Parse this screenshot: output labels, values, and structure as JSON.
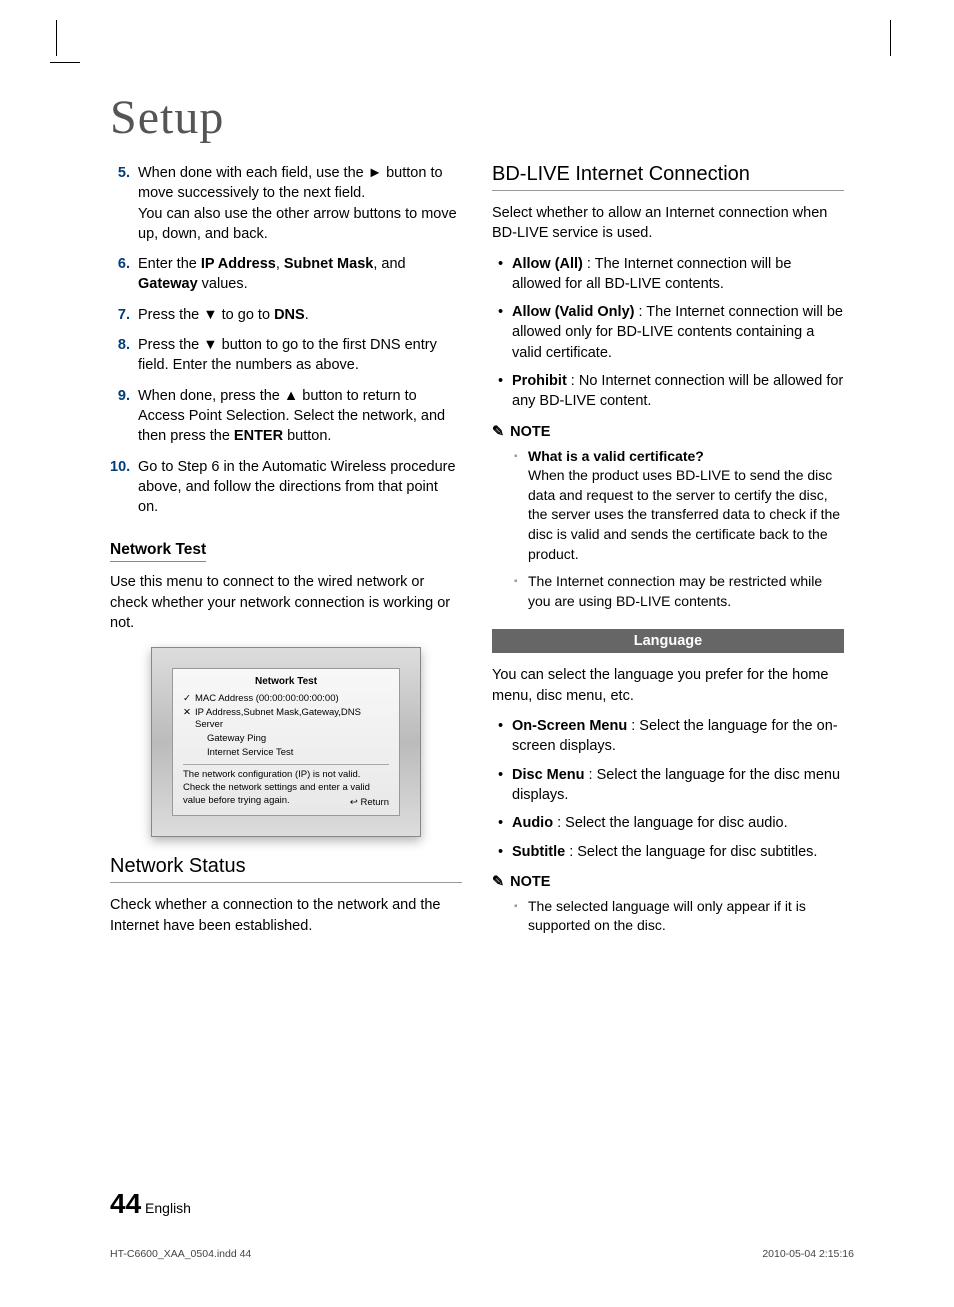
{
  "title": "Setup",
  "steps": [
    {
      "n": "5.",
      "html": "When done with each field, use the ► button to move successively to the next field.<br>You can also use the other arrow buttons to move up, down, and back."
    },
    {
      "n": "6.",
      "html": "Enter the <b>IP Address</b>, <b>Subnet Mask</b>, and <b>Gateway</b> values."
    },
    {
      "n": "7.",
      "html": "Press the ▼ to go to <b>DNS</b>."
    },
    {
      "n": "8.",
      "html": "Press the ▼ button to go to the first DNS entry field. Enter the numbers as above."
    },
    {
      "n": "9.",
      "html": "When done, press the ▲ button to return to Access Point Selection. Select the network, and then press the <b>ENTER</b> button."
    },
    {
      "n": "10.",
      "html": "Go to Step 6 in the Automatic Wireless procedure above, and follow the directions from that point on."
    }
  ],
  "network_test": {
    "heading": "Network Test",
    "para": "Use this menu to connect to the wired network or check whether your network connection is working or not.",
    "figure": {
      "title": "Network Test",
      "rows": [
        {
          "mark": "✓",
          "text": "MAC Address (00:00:00:00:00:00)"
        },
        {
          "mark": "✕",
          "text": "IP Address,Subnet Mask,Gateway,DNS Server"
        },
        {
          "mark": "",
          "text": "Gateway Ping",
          "indent": true
        },
        {
          "mark": "",
          "text": "Internet Service Test",
          "indent": true
        }
      ],
      "message": "The network configuration (IP) is not valid. Check the network settings and enter a valid value before trying again.",
      "return": "Return"
    }
  },
  "network_status": {
    "heading": "Network Status",
    "para": "Check whether a connection to the network and the Internet have been established."
  },
  "bdlive": {
    "heading": "BD-LIVE Internet Connection",
    "para": "Select whether to allow an Internet connection when BD-LIVE service is used.",
    "bullets": [
      "<b>Allow (All)</b> : The Internet connection will be allowed for all BD-LIVE contents.",
      "<b>Allow (Valid Only)</b> : The Internet connection will be allowed only for BD-LIVE contents containing a valid certificate.",
      "<b>Prohibit</b> : No Internet connection will be allowed for any BD-LIVE content."
    ],
    "note_label": "NOTE",
    "notes": [
      "<b>What is a valid certificate?</b><br>When the product uses BD-LIVE to send the disc data and request to the server to certify the disc, the server uses the transferred data to check if the disc is valid and sends the certificate back to the product.",
      "The Internet connection may be restricted while you are using BD-LIVE contents."
    ]
  },
  "language": {
    "heading": "Language",
    "para": "You can select the language you prefer for the home menu, disc menu, etc.",
    "bullets": [
      "<b>On-Screen Menu</b> : Select the language for the on-screen displays.",
      "<b>Disc Menu</b> : Select the language for the disc menu displays.",
      "<b>Audio</b> : Select the language for disc audio.",
      "<b>Subtitle</b> : Select the language for disc subtitles."
    ],
    "note_label": "NOTE",
    "notes": [
      "The selected language will only appear if it is supported on the disc."
    ]
  },
  "footer": {
    "page_num": "44",
    "lang": "English"
  },
  "meta": {
    "file": "HT-C6600_XAA_0504.indd   44",
    "timestamp": "2010-05-04   2:15:16"
  }
}
